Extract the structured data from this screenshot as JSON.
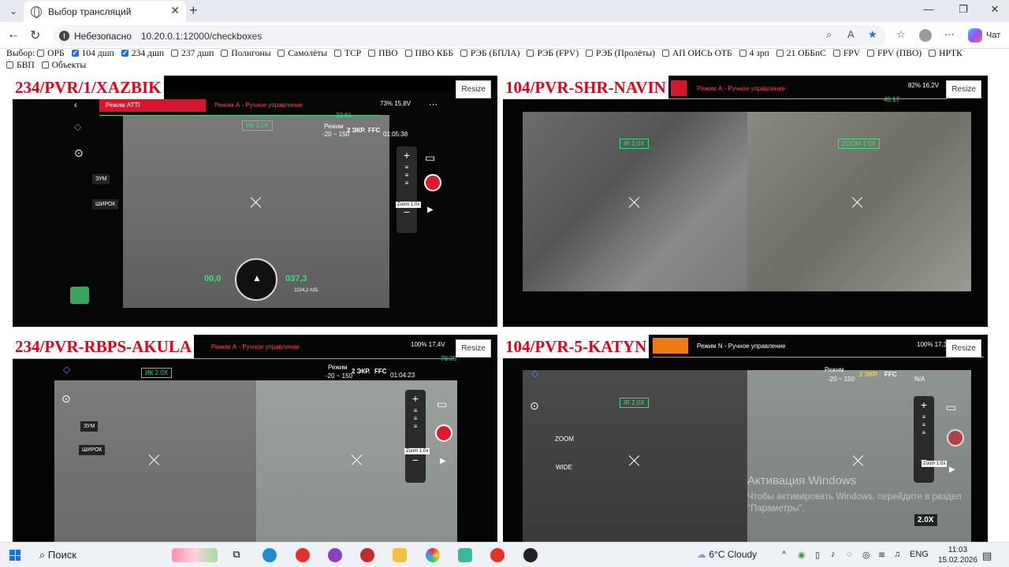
{
  "browser": {
    "tab_title": "Выбор трансляций",
    "security_label": "Небезопасно",
    "url": "10.20.0.1:12000/checkboxes",
    "chat_label": "Чат"
  },
  "filters": {
    "prefix": "Выбор:",
    "items": [
      {
        "label": "ОРБ",
        "checked": false
      },
      {
        "label": "104 дшп",
        "checked": true
      },
      {
        "label": "234 дшп",
        "checked": true
      },
      {
        "label": "237 дшп",
        "checked": false
      },
      {
        "label": "Полигоны",
        "checked": false
      },
      {
        "label": "Самолёты",
        "checked": false
      },
      {
        "label": "ТСР",
        "checked": false
      },
      {
        "label": "ПВО",
        "checked": false
      },
      {
        "label": "ПВО КББ",
        "checked": false
      },
      {
        "label": "РЭБ (БПЛА)",
        "checked": false
      },
      {
        "label": "РЭБ (FPV)",
        "checked": false
      },
      {
        "label": "РЭБ (Пролёты)",
        "checked": false
      },
      {
        "label": "АП ОИСЬ ОТБ",
        "checked": false
      },
      {
        "label": "4 зрп",
        "checked": false
      },
      {
        "label": "21 ОББпС",
        "checked": false
      },
      {
        "label": "FPV",
        "checked": false
      },
      {
        "label": "FPV (ПВО)",
        "checked": false
      },
      {
        "label": "НРТК",
        "checked": false
      },
      {
        "label": "БВП",
        "checked": false
      },
      {
        "label": "Объекты",
        "checked": false
      }
    ]
  },
  "panels": {
    "p1": {
      "title": "234/PVR/1/XAZBIK",
      "resize": "Resize",
      "mode_red": "Режим ATTI",
      "mode": "Режим А - Ручное управление",
      "zoom": "ИК 2.0X",
      "screen": "2 ЭКР.",
      "ffc": "FFC",
      "time": "01:05:38",
      "range": "-20 ~ 150",
      "mode_lbl": "Режим",
      "zoom_btn": "Zoom 1.0x",
      "zum": "ЗУМ",
      "wide": "ШИРОК",
      "timer": "33:61",
      "speed": "00,0",
      "alt": "037,3",
      "asl": "2224,2 ASL",
      "battery": "73% 15,8V"
    },
    "p2": {
      "title": "104/PVR-SHR-NAVIN",
      "resize": "Resize",
      "mode": "Режим А - Ручное управление",
      "zoom_ir": "IR 2.0X",
      "zoom_vis": "ZOOM 1.0X",
      "timer": "45:17",
      "battery": "82% 16,2V"
    },
    "p3": {
      "title": "234/PVR-RBPS-AKULA",
      "resize": "Resize",
      "mode": "Режим А - Ручное управление",
      "zoom": "ИК 2.0X",
      "screen": "2 ЭКР.",
      "ffc": "FFC",
      "time": "01:04:23",
      "range": "-20 ~ 150",
      "mode_lbl": "Режим",
      "zoom_btn": "Zoom 1.0x",
      "zum": "ЗУМ",
      "wide": "ШИРОК",
      "timer": "70:05",
      "battery": "100% 17,4V"
    },
    "p4": {
      "title": "104/PVR-5-KATYN",
      "resize": "Resize",
      "mode": "Режим N - Ручное управление",
      "zoom_ir": "IR 2.0X",
      "screen": "2 ЭКР.",
      "ffc": "FFC",
      "na": "N/A",
      "range": "-20 ~ 150",
      "mode_lbl": "Режим",
      "zoom_btn": "Zoom 1.0x",
      "zoom_lbl": "ZOOM",
      "wide": "WIDE",
      "zoom_level": "2.0X",
      "battery": "100% 17,3V"
    }
  },
  "watermark": {
    "title": "Активация Windows",
    "text": "Чтобы активировать Windows, перейдите в раздел \"Параметры\"."
  },
  "taskbar": {
    "search": "Поиск",
    "weather": "6°C  Cloudy",
    "lang": "ENG",
    "time": "11:03",
    "date": "15.02.2026"
  }
}
